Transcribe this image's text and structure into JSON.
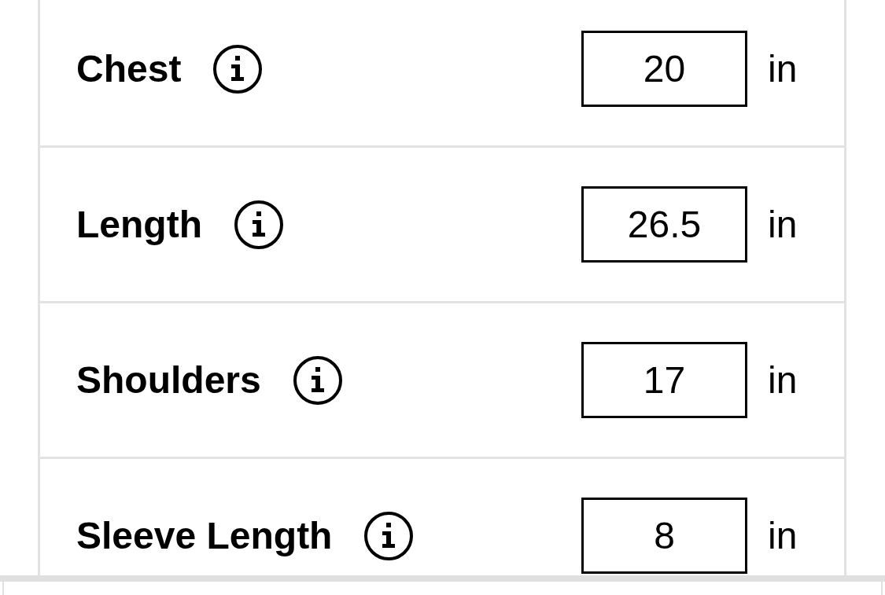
{
  "measurements": [
    {
      "label": "Chest",
      "value": "20",
      "unit": "in"
    },
    {
      "label": "Length",
      "value": "26.5",
      "unit": "in"
    },
    {
      "label": "Shoulders",
      "value": "17",
      "unit": "in"
    },
    {
      "label": "Sleeve Length",
      "value": "8",
      "unit": "in"
    }
  ]
}
